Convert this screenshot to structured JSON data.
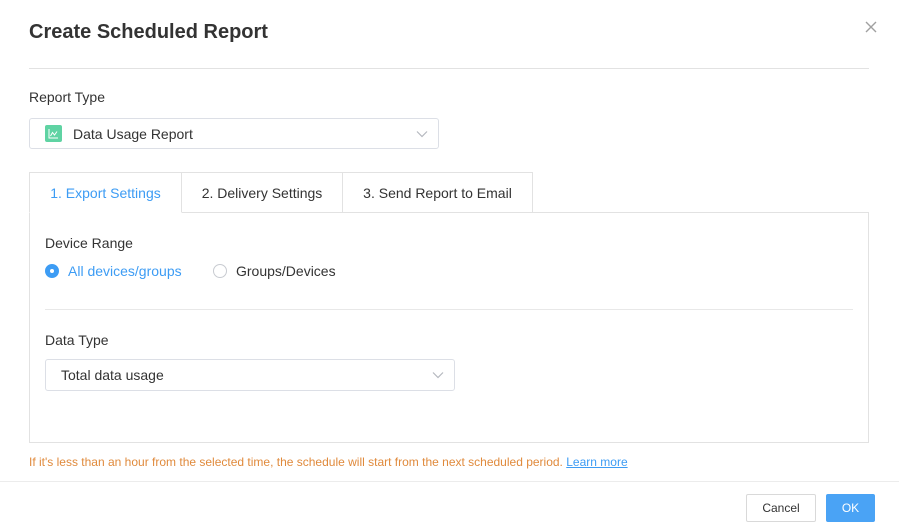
{
  "dialog": {
    "title": "Create Scheduled Report",
    "close_icon": "close-icon"
  },
  "report_type": {
    "label": "Report Type",
    "selected": "Data Usage Report",
    "icon": "chart-line-icon",
    "icon_color": "#5fd3a3"
  },
  "tabs": [
    {
      "label": "1. Export Settings",
      "active": true
    },
    {
      "label": "2. Delivery Settings",
      "active": false
    },
    {
      "label": "3. Send Report to Email",
      "active": false
    }
  ],
  "export_settings": {
    "device_range": {
      "label": "Device Range",
      "options": [
        {
          "label": "All devices/groups",
          "checked": true
        },
        {
          "label": "Groups/Devices",
          "checked": false
        }
      ]
    },
    "data_type": {
      "label": "Data Type",
      "selected": "Total data usage"
    }
  },
  "notice": {
    "text": "If it's less than an hour from the selected time, the schedule will start from the next scheduled period.",
    "link": "Learn more",
    "color": "#e08a3c"
  },
  "footer": {
    "cancel_label": "Cancel",
    "ok_label": "OK"
  },
  "colors": {
    "accent": "#3d9cf4",
    "ok_button": "#4aa3f5"
  }
}
